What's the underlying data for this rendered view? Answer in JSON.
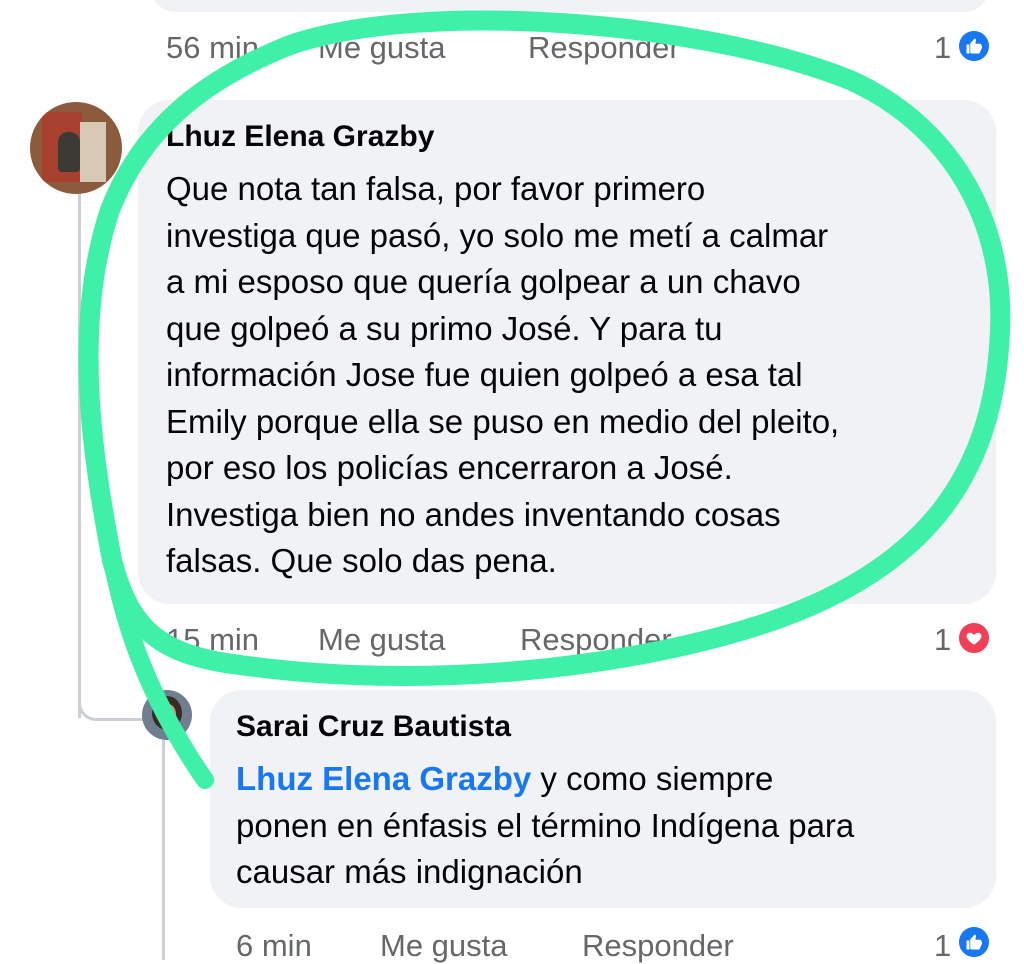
{
  "top_comment": {
    "time": "56 min",
    "like_label": "Me gusta",
    "reply_label": "Responder",
    "reaction_count": "1",
    "reaction_icon": "like-icon"
  },
  "main_comment": {
    "author": "Lhuz Elena Grazby",
    "text_lines": [
      "Que nota tan falsa, por favor primero",
      "investiga que pasó, yo solo me metí a calmar",
      "a mi esposo que quería golpear a un chavo",
      "que golpeó a su primo José. Y para tu",
      "información Jose fue quien golpeó a esa tal",
      "Emily porque ella se puso en medio del pleito,",
      "por eso los policías encerraron a José.",
      "Investiga bien no andes inventando cosas",
      "falsas. Que solo das pena."
    ],
    "time": "15 min",
    "like_label": "Me gusta",
    "reply_label": "Responder",
    "reaction_count": "1",
    "reaction_icon": "love-icon"
  },
  "reply_comment": {
    "author": "Sarai Cruz Bautista",
    "mention": "Lhuz Elena Grazby",
    "text_lines": [
      " y como siempre",
      "ponen en énfasis el término Indígena para",
      "causar más indignación"
    ],
    "time": "6 min",
    "like_label": "Me gusta",
    "reply_label": "Responder",
    "reaction_count": "1",
    "reaction_icon": "like-icon"
  },
  "colors": {
    "highlight": "#3ff0a8",
    "bubble": "#f0f2f5",
    "meta_text": "#65676b",
    "mention": "#1877f2",
    "like": "#1877f2",
    "love": "#f33e58"
  }
}
